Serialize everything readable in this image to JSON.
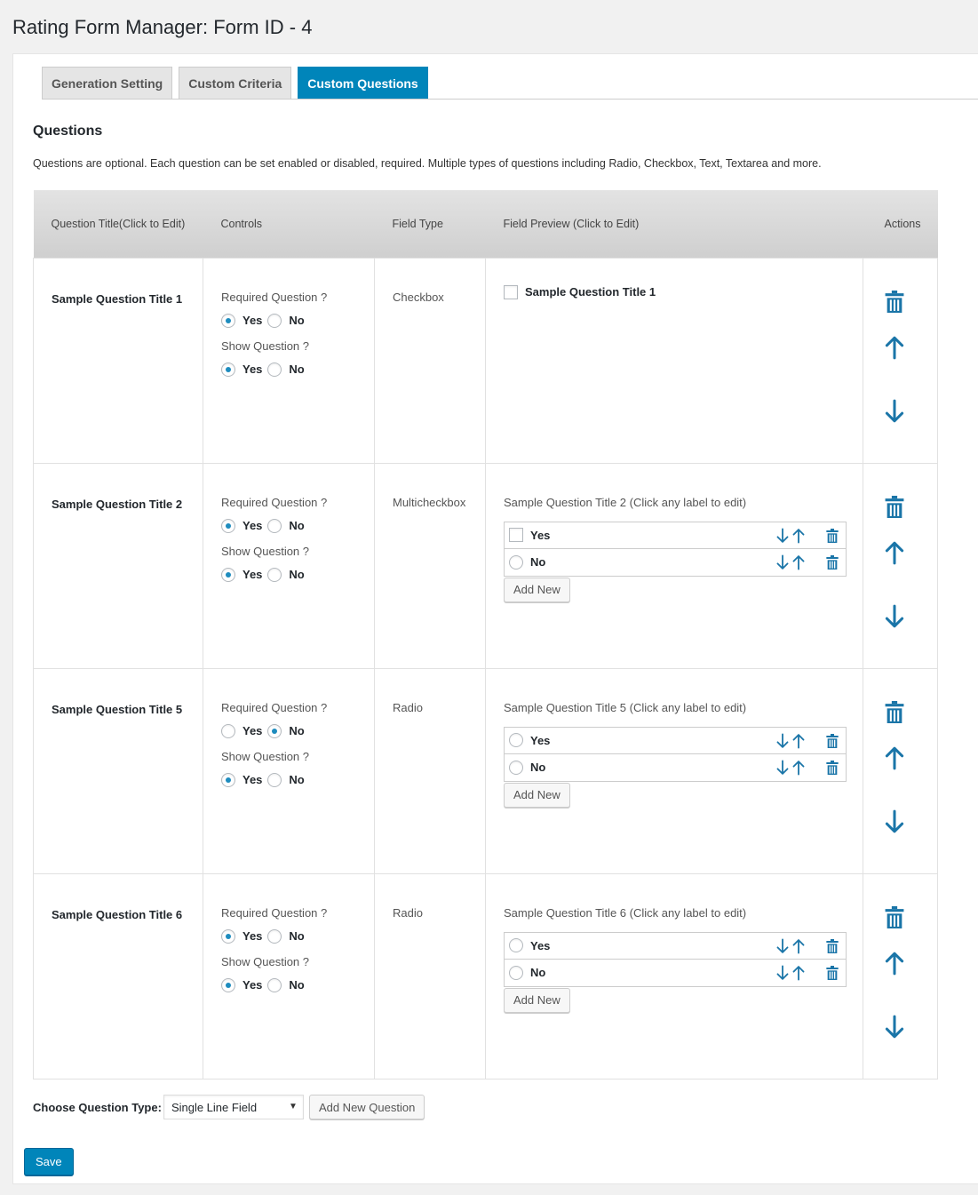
{
  "page_title": "Rating Form Manager: Form ID - 4",
  "tabs": [
    {
      "label": "Generation Setting",
      "active": false
    },
    {
      "label": "Custom Criteria",
      "active": false
    },
    {
      "label": "Custom Questions",
      "active": true
    }
  ],
  "section": {
    "title": "Questions",
    "description": "Questions are optional. Each question can be set enabled or disabled, required. Multiple types of questions including Radio, Checkbox, Text, Textarea and more."
  },
  "table": {
    "headers": [
      "Question Title(Click to Edit)",
      "Controls",
      "Field Type",
      "Field Preview (Click to Edit)",
      "Actions"
    ],
    "controls_labels": {
      "required": "Required Question ?",
      "show": "Show Question ?",
      "yes": "Yes",
      "no": "No"
    },
    "rows": [
      {
        "title": "Sample Question Title 1",
        "required": "yes",
        "show": "yes",
        "field_type": "Checkbox",
        "preview_kind": "single-checkbox",
        "preview_label": "Sample Question Title 1"
      },
      {
        "title": "Sample Question Title 2",
        "required": "yes",
        "show": "yes",
        "field_type": "Multicheckbox",
        "preview_kind": "options",
        "preview_caption": "Sample Question Title 2 (Click any label to edit)",
        "options": [
          {
            "label": "Yes",
            "input": "checkbox"
          },
          {
            "label": "No",
            "input": "radio"
          }
        ],
        "add_new_label": "Add New"
      },
      {
        "title": "Sample Question Title 5",
        "required": "no",
        "show": "yes",
        "field_type": "Radio",
        "preview_kind": "options",
        "preview_caption": "Sample Question Title 5 (Click any label to edit)",
        "options": [
          {
            "label": "Yes",
            "input": "radio"
          },
          {
            "label": "No",
            "input": "radio"
          }
        ],
        "add_new_label": "Add New"
      },
      {
        "title": "Sample Question Title 6",
        "required": "yes",
        "show": "yes",
        "field_type": "Radio",
        "preview_kind": "options",
        "preview_caption": "Sample Question Title 6 (Click any label to edit)",
        "options": [
          {
            "label": "Yes",
            "input": "radio"
          },
          {
            "label": "No",
            "input": "radio"
          }
        ],
        "add_new_label": "Add New"
      }
    ]
  },
  "footer": {
    "choose_type_label": "Choose Question Type:",
    "select_value": "Single Line Field",
    "add_question_label": "Add New Question",
    "save_label": "Save"
  },
  "icons": {
    "delete": "trash-icon",
    "move_up": "arrow-up-icon",
    "move_down": "arrow-down-icon",
    "dropdown": "chevron-down-icon"
  },
  "colors": {
    "accent": "#0085ba",
    "icon": "#1a75a8",
    "radio_dot": "#1e8cbe"
  }
}
